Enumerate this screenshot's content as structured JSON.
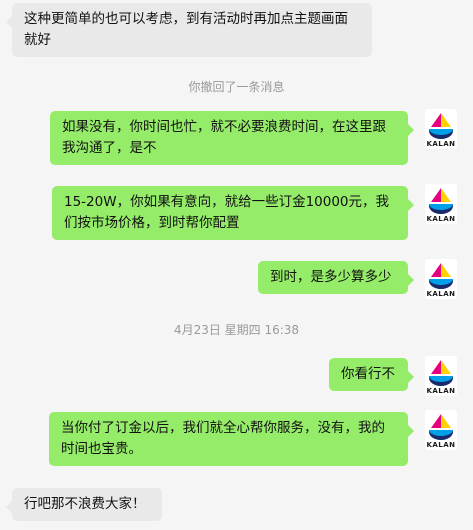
{
  "messages": [
    {
      "side": "in",
      "text": "这种更简单的也可以考虑，到有活动时再加点主题画面就好"
    },
    {
      "side": "out",
      "text": "如果没有，你时间也忙，就不必要浪费时间，在这里跟我沟通了，是不"
    },
    {
      "side": "out",
      "text": "15-20W，你如果有意向，就给一些订金10000元，我们按市场价格，到时帮你配置"
    },
    {
      "side": "out",
      "text": "到时，是多少算多少"
    },
    {
      "side": "out",
      "text": "你看行不"
    },
    {
      "side": "out",
      "text": "当你付了订金以后，我们就全心帮你服务，没有，我的时间也宝贵。"
    },
    {
      "side": "in",
      "text": "行吧那不浪费大家！"
    }
  ],
  "system": {
    "recall_notice": "你撤回了一条消息",
    "timestamp": "4月23日 星期四 16:38"
  },
  "avatar": {
    "brand": "KALAN",
    "colors": {
      "magenta": "#e6007e",
      "yellow": "#ffd200",
      "cyan": "#00a0e9",
      "navy": "#1b2a6b"
    }
  }
}
